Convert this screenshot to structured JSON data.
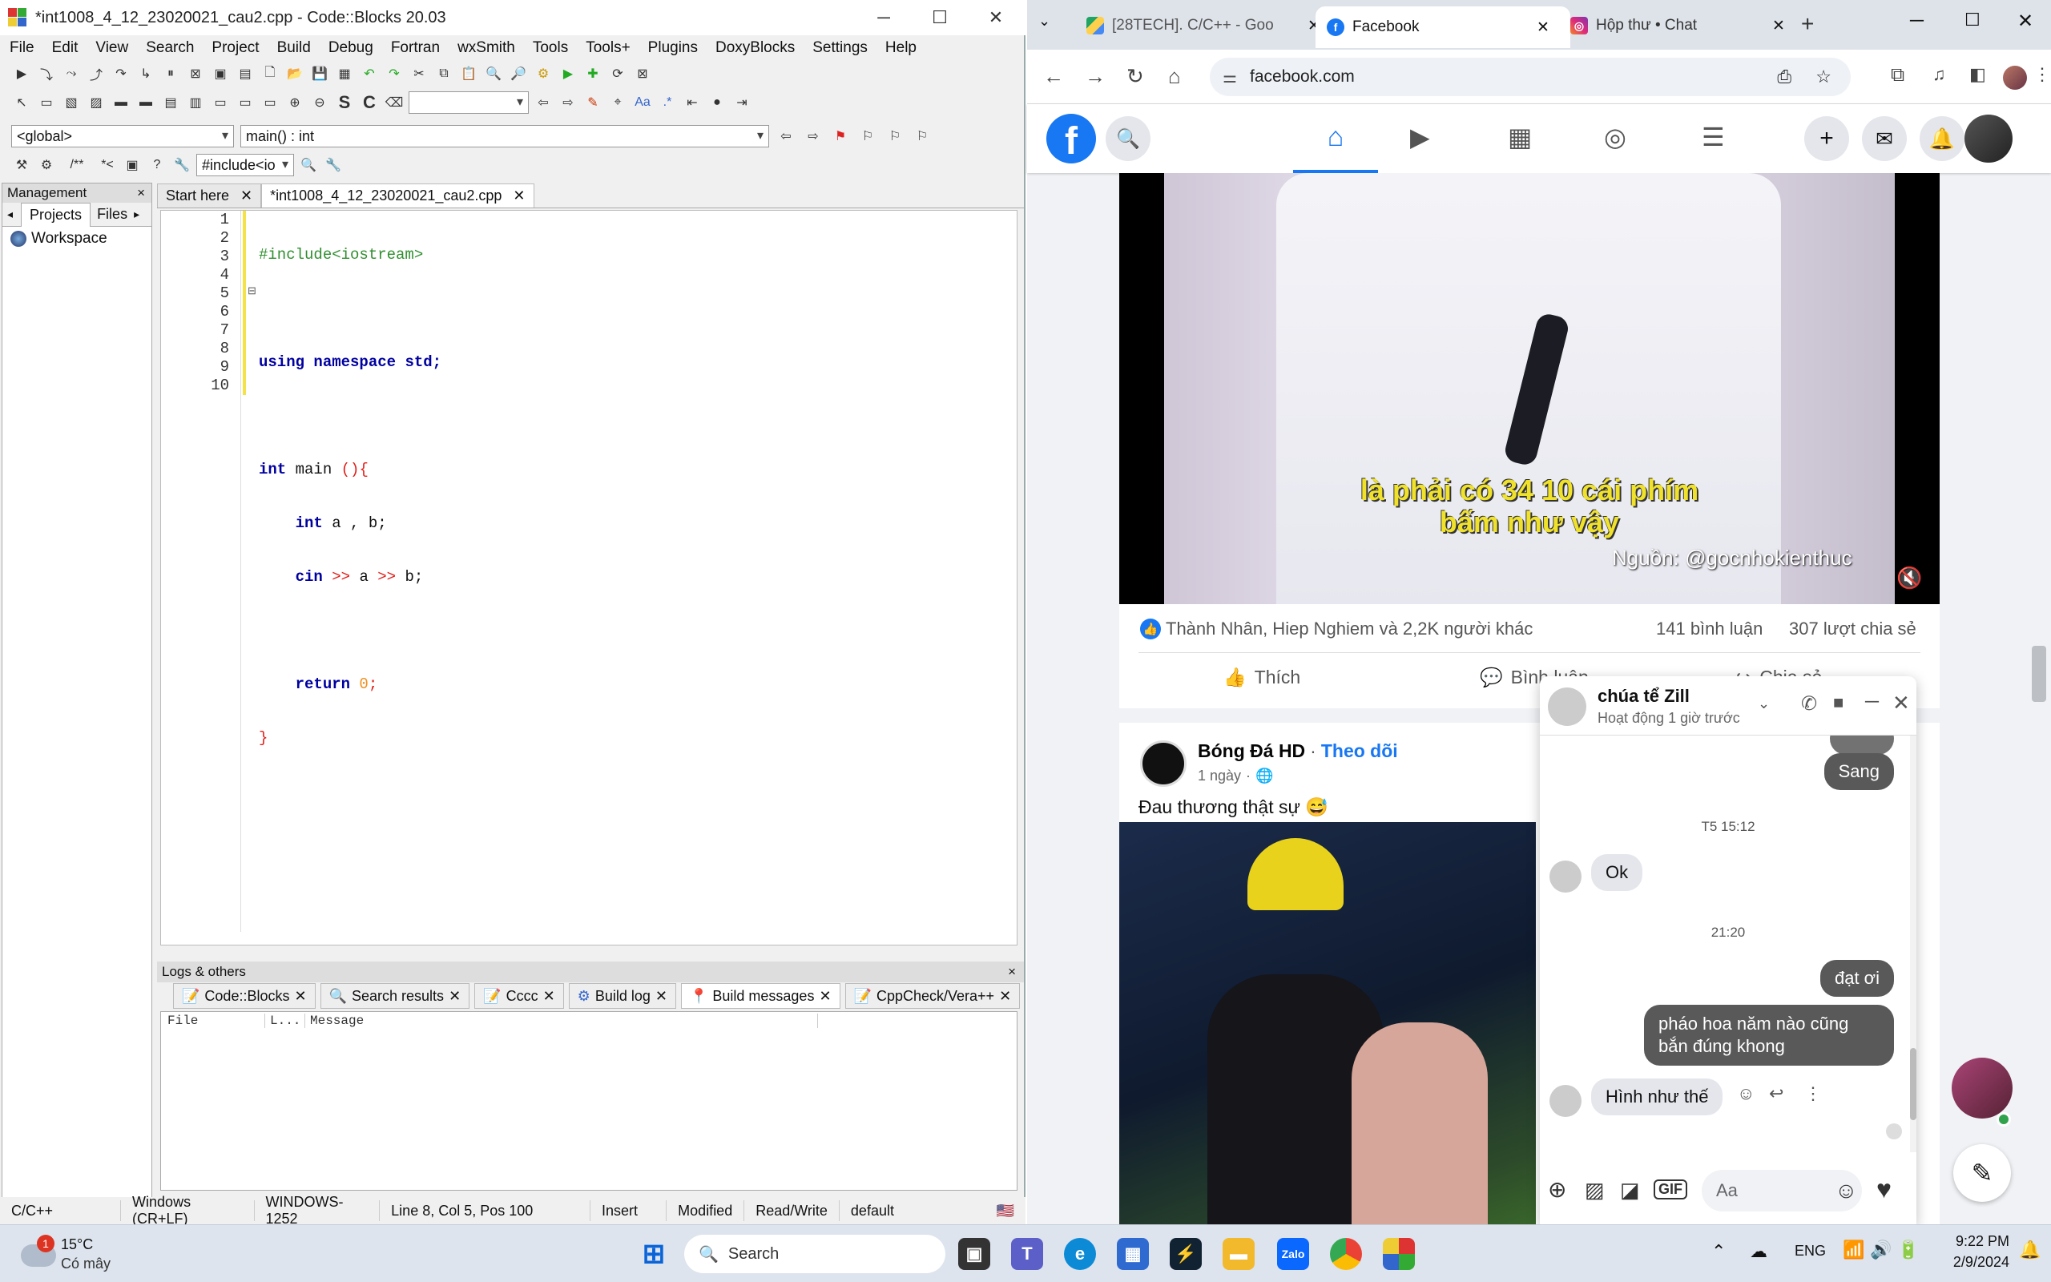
{
  "codeblocks": {
    "title": "*int1008_4_12_23020021_cau2.cpp - Code::Blocks 20.03",
    "menu": [
      "File",
      "Edit",
      "View",
      "Search",
      "Project",
      "Build",
      "Debug",
      "Fortran",
      "wxSmith",
      "Tools",
      "Tools+",
      "Plugins",
      "DoxyBlocks",
      "Settings",
      "Help"
    ],
    "scope_combo": "<global>",
    "function_combo": "main() : int",
    "include_combo": "#include<io",
    "management": {
      "title": "Management",
      "tabs": [
        "Projects",
        "Files"
      ],
      "workspace": "Workspace"
    },
    "editor_tabs": [
      "Start here",
      "*int1008_4_12_23020021_cau2.cpp"
    ],
    "line_numbers": [
      "1",
      "2",
      "3",
      "4",
      "5",
      "6",
      "7",
      "8",
      "9",
      "10"
    ],
    "code": {
      "l1": "#include<iostream>",
      "l3a": "using",
      "l3b": "namespace",
      "l3c": "std;",
      "l5a": "int",
      "l5b": " main ",
      "l5c": "(){",
      "l6a": "int",
      "l6b": " a , b;",
      "l7a": "cin",
      "l7b": " >> ",
      "l7c": "a",
      "l7d": " >> ",
      "l7e": "b;",
      "l9a": "return",
      "l9b": " 0",
      "l9c": ";",
      "l10": "}"
    },
    "logs": {
      "title": "Logs & others",
      "tabs": [
        "Code::Blocks",
        "Search results",
        "Cccc",
        "Build log",
        "Build messages",
        "CppCheck/Vera++"
      ],
      "columns": [
        "File",
        "L...",
        "Message"
      ]
    },
    "status": [
      "C/C++",
      "Windows (CR+LF)",
      "WINDOWS-1252",
      "Line 8, Col 5, Pos 100",
      "Insert",
      "Modified",
      "Read/Write",
      "default"
    ]
  },
  "browser": {
    "tabs": [
      {
        "title": "[28TECH]. C/C++ - Goo",
        "icon": "google-drive-icon"
      },
      {
        "title": "Facebook",
        "icon": "facebook-icon"
      },
      {
        "title": "Hộp thư • Chat",
        "icon": "instagram-icon"
      }
    ],
    "url": "facebook.com",
    "video": {
      "subtitle1": "là phải có 34 10 cái phím",
      "subtitle2": "bấm như vậy",
      "source": "Nguồn: @gocnhokienthuc"
    },
    "post1": {
      "reactions": "Thành Nhân, Hiep Nghiem và 2,2K người khác",
      "comments": "141 bình luận",
      "shares": "307 lượt chia sẻ",
      "like": "Thích",
      "comment": "Bình luận",
      "share": "Chia sẻ"
    },
    "post2": {
      "page": "Bóng Đá HD",
      "follow": "Theo dõi",
      "time": "1 ngày",
      "text": "Đau thương thật sự 😅"
    },
    "chat": {
      "name": "chúa tể Zill",
      "status": "Hoạt động 1 giờ trước",
      "msg_sang": "Sang",
      "time1": "T5 15:12",
      "msg_ok": "Ok",
      "time2": "21:20",
      "msg_dat": "đạt ơi",
      "msg_phao": "pháo hoa năm nào cũng bắn đúng khong",
      "msg_reply": "Hình như thế",
      "input_placeholder": "Aa"
    }
  },
  "taskbar": {
    "weather_temp": "15°C",
    "weather_desc": "Có mây",
    "weather_badge": "1",
    "search": "Search",
    "lang": "ENG",
    "time": "9:22 PM",
    "date": "2/9/2024"
  }
}
